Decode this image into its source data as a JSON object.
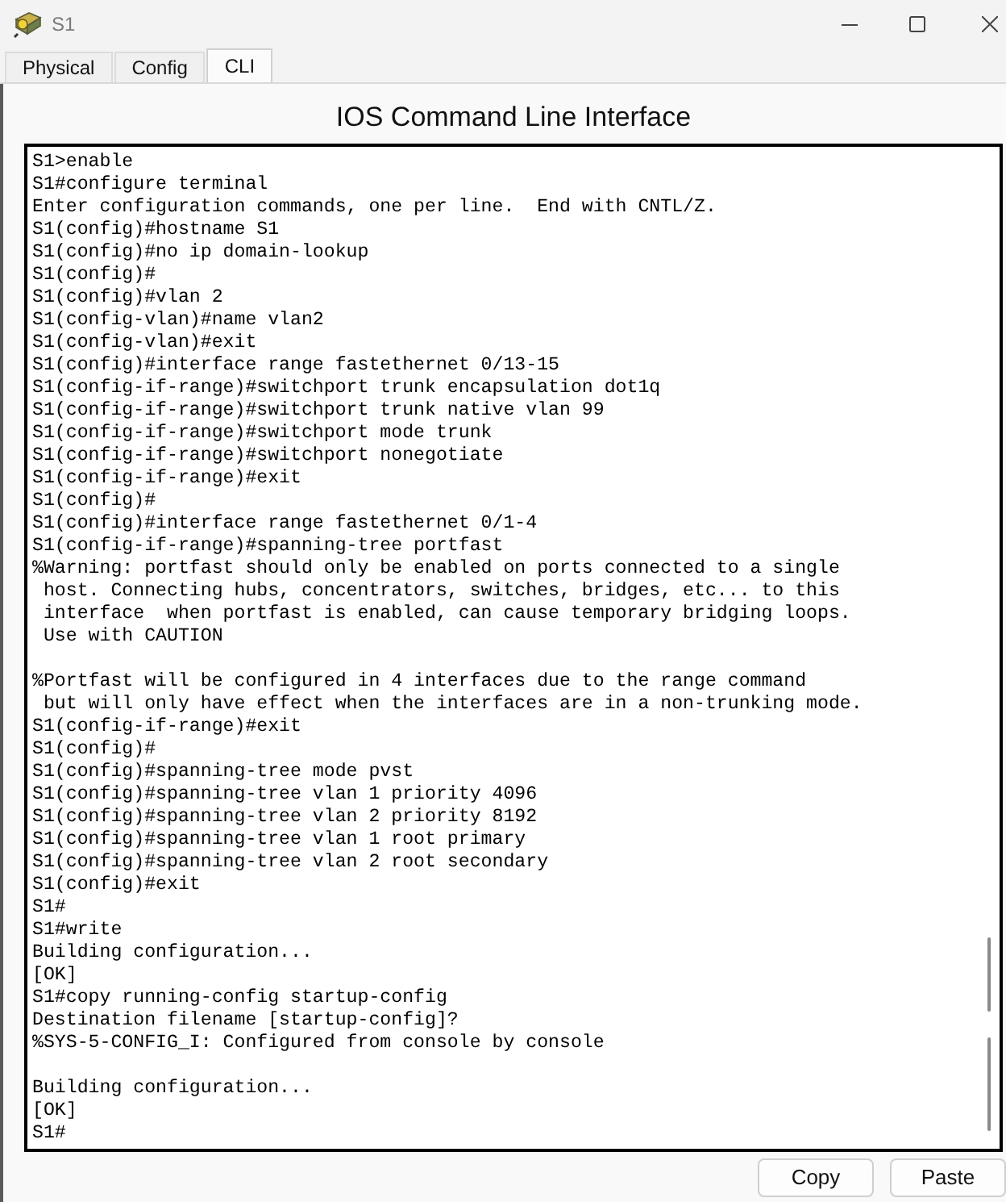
{
  "window": {
    "title": "S1"
  },
  "tabs": [
    {
      "label": "Physical",
      "selected": false
    },
    {
      "label": "Config",
      "selected": false
    },
    {
      "label": "CLI",
      "selected": true
    }
  ],
  "panel": {
    "title": "IOS Command Line Interface"
  },
  "terminal": {
    "blocks": [
      [
        "S1>enable",
        "S1#configure terminal",
        "Enter configuration commands, one per line.  End with CNTL/Z.",
        "S1(config)#hostname S1",
        "S1(config)#no ip domain-lookup",
        "S1(config)#",
        "S1(config)#vlan 2",
        "S1(config-vlan)#name vlan2",
        "S1(config-vlan)#exit",
        "S1(config)#interface range fastethernet 0/13-15",
        "S1(config-if-range)#switchport trunk encapsulation dot1q",
        "S1(config-if-range)#switchport trunk native vlan 99",
        "S1(config-if-range)#switchport mode trunk",
        "S1(config-if-range)#switchport nonegotiate",
        "S1(config-if-range)#exit",
        "S1(config)#",
        "S1(config)#interface range fastethernet 0/1-4",
        "S1(config-if-range)#spanning-tree portfast",
        "%Warning: portfast should only be enabled on ports connected to a single",
        " host. Connecting hubs, concentrators, switches, bridges, etc... to this",
        " interface  when portfast is enabled, can cause temporary bridging loops.",
        " Use with CAUTION"
      ],
      [
        "%Portfast will be configured in 4 interfaces due to the range command",
        " but will only have effect when the interfaces are in a non-trunking mode.",
        "S1(config-if-range)#exit",
        "S1(config)#",
        "S1(config)#spanning-tree mode pvst",
        "S1(config)#spanning-tree vlan 1 priority 4096",
        "S1(config)#spanning-tree vlan 2 priority 8192",
        "S1(config)#spanning-tree vlan 1 root primary",
        "S1(config)#spanning-tree vlan 2 root secondary",
        "S1(config)#exit",
        "S1#",
        "S1#write",
        "Building configuration...",
        "[OK]",
        "S1#copy running-config startup-config",
        "Destination filename [startup-config]?",
        "%SYS-5-CONFIG_I: Configured from console by console"
      ],
      [
        "Building configuration...",
        "[OK]",
        "S1#"
      ]
    ]
  },
  "buttons": [
    {
      "label": "Copy"
    },
    {
      "label": "Paste"
    }
  ]
}
